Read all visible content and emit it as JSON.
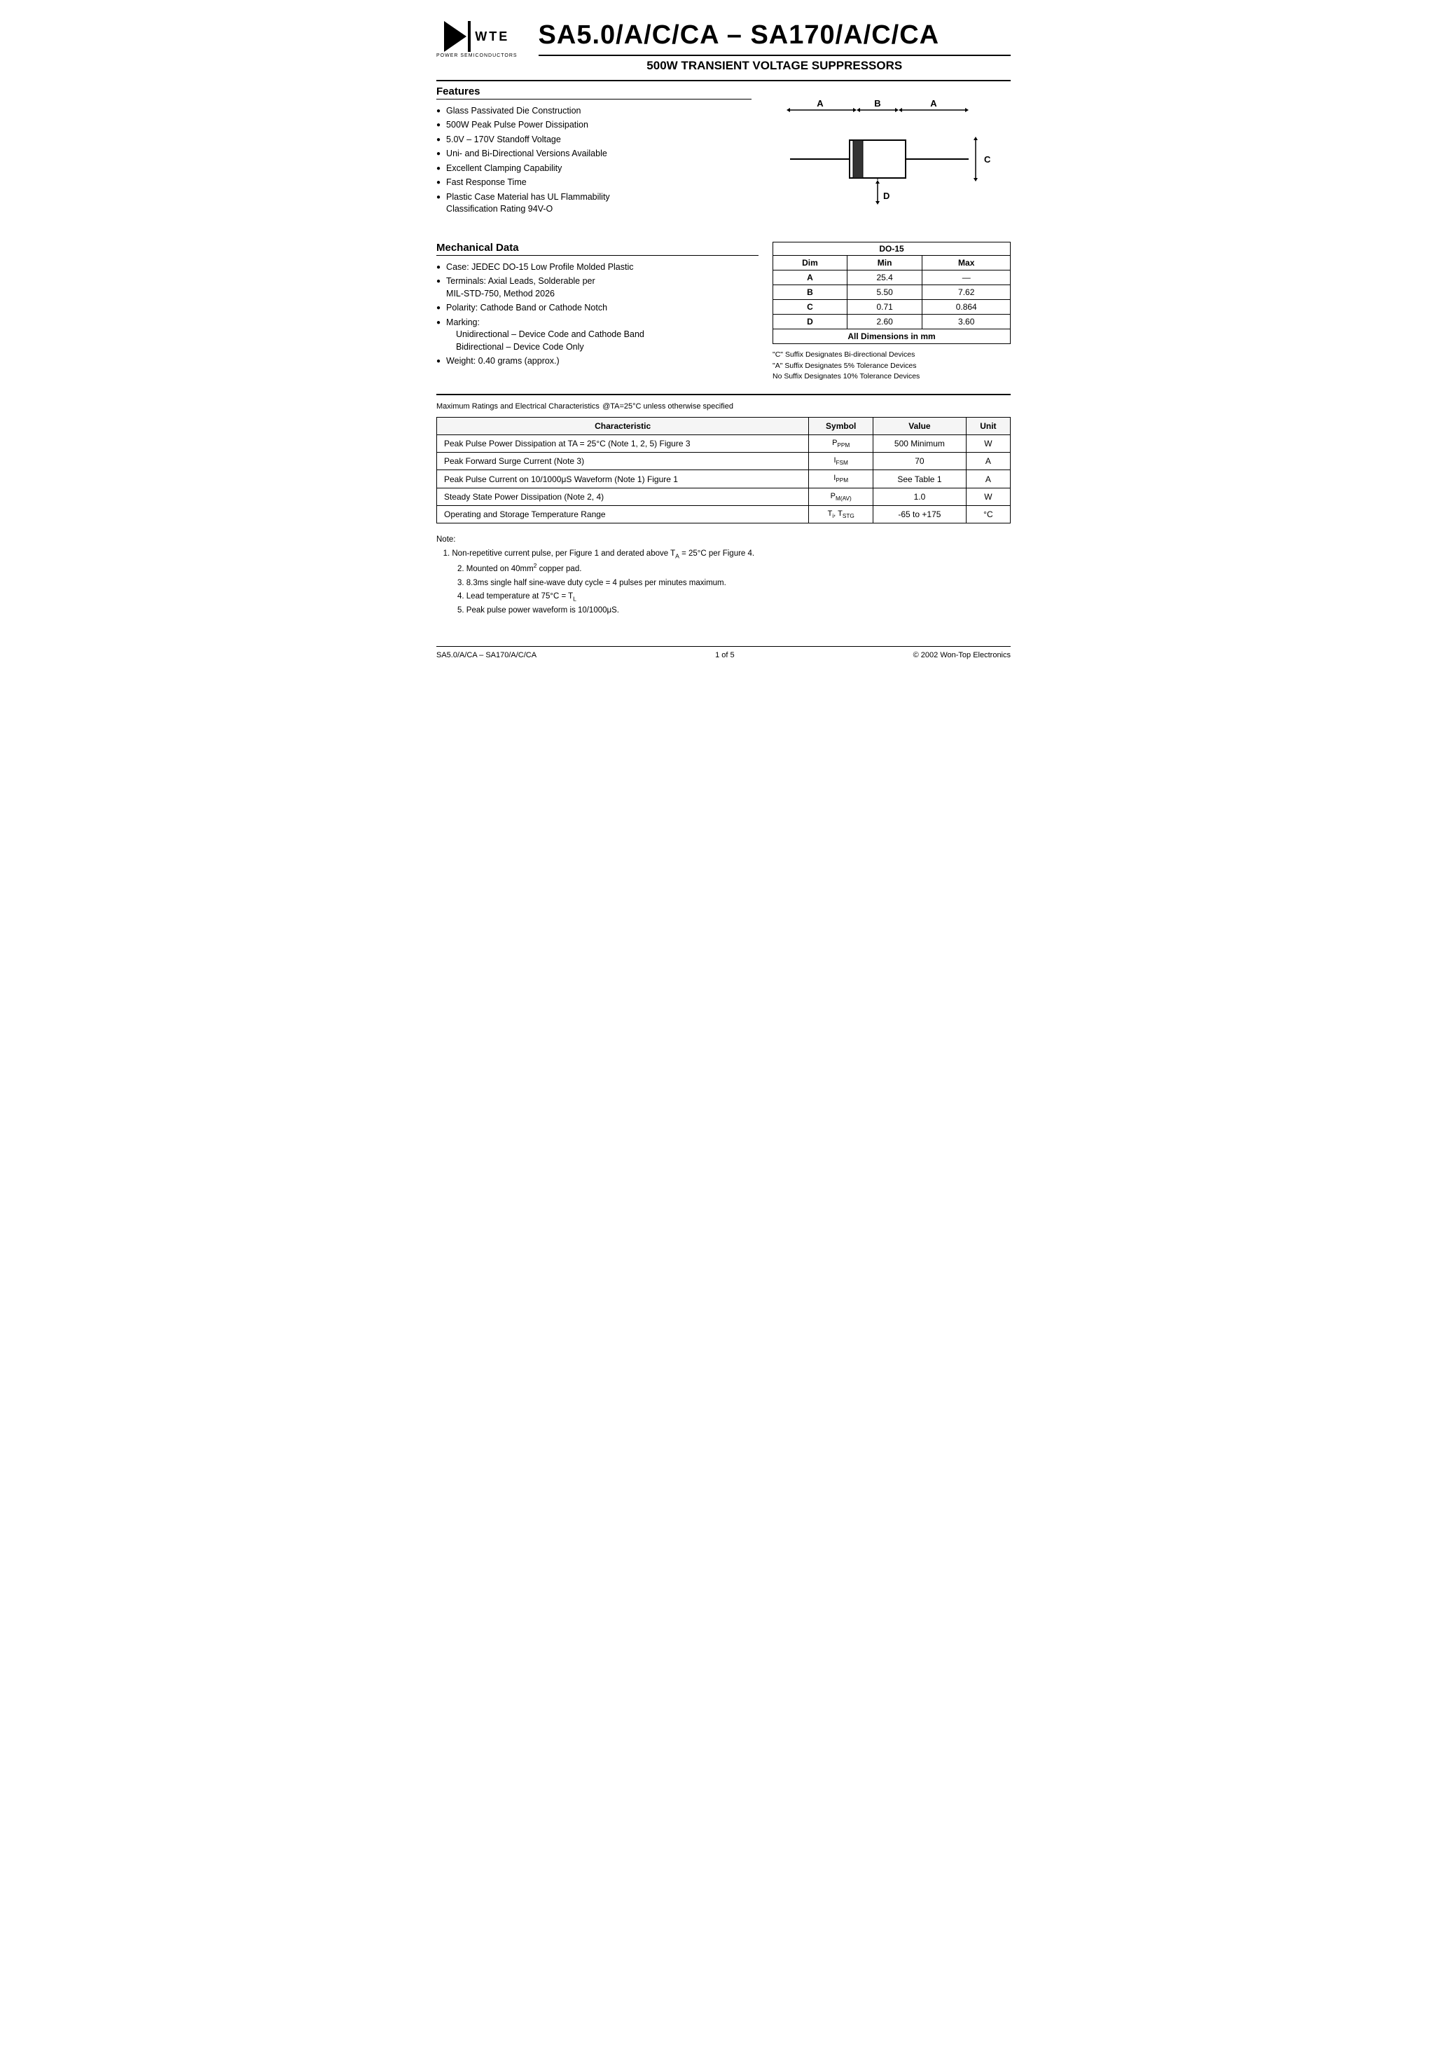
{
  "header": {
    "main_title": "SA5.0/A/C/CA – SA170/A/C/CA",
    "sub_title": "500W TRANSIENT VOLTAGE SUPPRESSORS",
    "logo_text": "WTE",
    "logo_sub": "POWER SEMICONDUCTORS"
  },
  "features": {
    "heading": "Features",
    "items": [
      "Glass Passivated Die Construction",
      "500W Peak Pulse Power Dissipation",
      "5.0V – 170V Standoff Voltage",
      "Uni- and Bi-Directional Versions Available",
      "Excellent Clamping Capability",
      "Fast Response Time",
      "Plastic Case Material has UL Flammability Classification Rating 94V-O"
    ]
  },
  "mechanical": {
    "heading": "Mechanical Data",
    "items": [
      "Case: JEDEC DO-15 Low Profile Molded Plastic",
      "Terminals: Axial Leads, Solderable per MIL-STD-750, Method 2026",
      "Polarity: Cathode Band or Cathode Notch",
      "Marking:",
      "Unidirectional – Device Code and Cathode Band",
      "Bidirectional – Device Code Only",
      "Weight: 0.40 grams (approx.)"
    ]
  },
  "dim_table": {
    "title": "DO-15",
    "headers": [
      "Dim",
      "Min",
      "Max"
    ],
    "rows": [
      {
        "dim": "A",
        "min": "25.4",
        "max": "—"
      },
      {
        "dim": "B",
        "min": "5.50",
        "max": "7.62"
      },
      {
        "dim": "C",
        "min": "0.71",
        "max": "0.864"
      },
      {
        "dim": "D",
        "min": "2.60",
        "max": "3.60"
      }
    ],
    "footer": "All Dimensions in mm"
  },
  "suffix_notes": [
    "\"C\" Suffix Designates Bi-directional Devices",
    "\"A\" Suffix Designates 5% Tolerance Devices",
    "No Suffix Designates 10% Tolerance Devices"
  ],
  "max_ratings": {
    "heading": "Maximum Ratings and Electrical Characteristics",
    "condition": "@TA=25°C unless otherwise specified",
    "table_headers": [
      "Characteristic",
      "Symbol",
      "Value",
      "Unit"
    ],
    "rows": [
      {
        "char": "Peak Pulse Power Dissipation at TA = 25°C (Note 1, 2, 5) Figure 3",
        "symbol": "PPPM",
        "value": "500 Minimum",
        "unit": "W"
      },
      {
        "char": "Peak Forward Surge Current (Note 3)",
        "symbol": "IFSM",
        "value": "70",
        "unit": "A"
      },
      {
        "char": "Peak Pulse Current on 10/1000μS Waveform (Note 1) Figure 1",
        "symbol": "IPPM",
        "value": "See Table 1",
        "unit": "A"
      },
      {
        "char": "Steady State Power Dissipation (Note 2, 4)",
        "symbol": "PM(AV)",
        "value": "1.0",
        "unit": "W"
      },
      {
        "char": "Operating and Storage Temperature Range",
        "symbol": "Ti, TSTG",
        "value": "-65 to +175",
        "unit": "°C"
      }
    ]
  },
  "notes": {
    "heading": "Note:",
    "items": [
      "1. Non-repetitive current pulse, per Figure 1 and derated above TA = 25°C per Figure 4.",
      "2. Mounted on 40mm² copper pad.",
      "3. 8.3ms single half sine-wave duty cycle = 4 pulses per minutes maximum.",
      "4. Lead temperature at 75°C = TL",
      "5. Peak pulse power waveform is 10/1000μS."
    ]
  },
  "footer": {
    "left": "SA5.0/A/CA – SA170/A/C/CA",
    "center": "1 of 5",
    "right": "© 2002 Won-Top Electronics"
  }
}
